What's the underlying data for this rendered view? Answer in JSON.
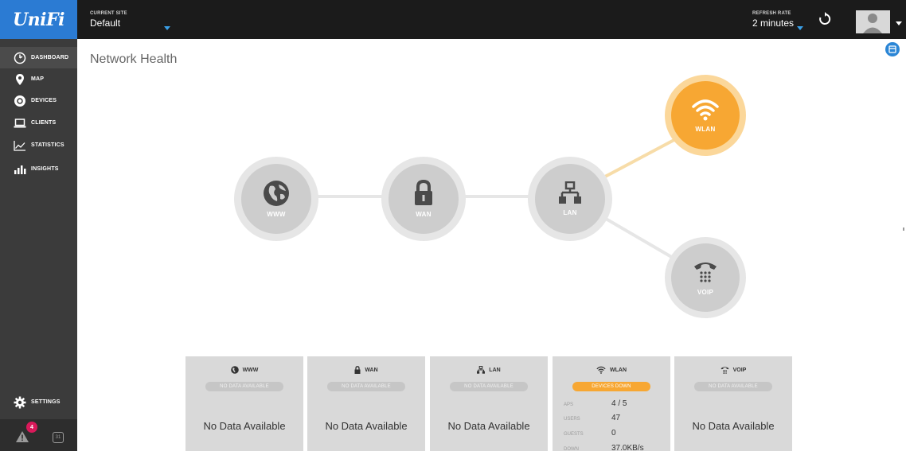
{
  "brand": {
    "logo_text": "UniFi"
  },
  "header": {
    "site_label": "CURRENT SITE",
    "site_value": "Default",
    "refresh_label": "REFRESH RATE",
    "refresh_value": "2 minutes"
  },
  "sidebar": {
    "items": [
      {
        "label": "DASHBOARD",
        "icon": "dashboard-icon"
      },
      {
        "label": "MAP",
        "icon": "map-pin-icon"
      },
      {
        "label": "DEVICES",
        "icon": "devices-icon"
      },
      {
        "label": "CLIENTS",
        "icon": "laptop-icon"
      },
      {
        "label": "STATISTICS",
        "icon": "line-chart-icon"
      },
      {
        "label": "INSIGHTS",
        "icon": "bar-chart-icon"
      }
    ],
    "settings_label": "SETTINGS",
    "alert_count": "4",
    "calendar_day": "31"
  },
  "main": {
    "title": "Network Health",
    "nodes": [
      {
        "label": "WWW",
        "icon": "globe-icon",
        "status": "grey"
      },
      {
        "label": "WAN",
        "icon": "lock-icon",
        "status": "grey"
      },
      {
        "label": "LAN",
        "icon": "network-icon",
        "status": "grey"
      },
      {
        "label": "WLAN",
        "icon": "wifi-icon",
        "status": "warning"
      },
      {
        "label": "VOIP",
        "icon": "phone-icon",
        "status": "grey"
      }
    ]
  },
  "cards": [
    {
      "title": "WWW",
      "icon": "globe-icon",
      "status": "NO DATA AVAILABLE",
      "body": "No Data Available"
    },
    {
      "title": "WAN",
      "icon": "lock-icon",
      "status": "NO DATA AVAILABLE",
      "body": "No Data Available"
    },
    {
      "title": "LAN",
      "icon": "network-icon",
      "status": "NO DATA AVAILABLE",
      "body": "No Data Available"
    },
    {
      "title": "WLAN",
      "icon": "wifi-icon",
      "status": "DEVICES DOWN",
      "stats": [
        {
          "key": "APS",
          "value": "4 / 5"
        },
        {
          "key": "USERS",
          "value": "47"
        },
        {
          "key": "GUESTS",
          "value": "0"
        },
        {
          "key": "DOWN",
          "value": "37.0KB/s"
        }
      ]
    },
    {
      "title": "VOIP",
      "icon": "phone-icon",
      "status": "NO DATA AVAILABLE",
      "body": "No Data Available"
    }
  ],
  "colors": {
    "accent": "#2b7bd3",
    "warning": "#f7a733",
    "node_grey": "#cfcfcf"
  }
}
